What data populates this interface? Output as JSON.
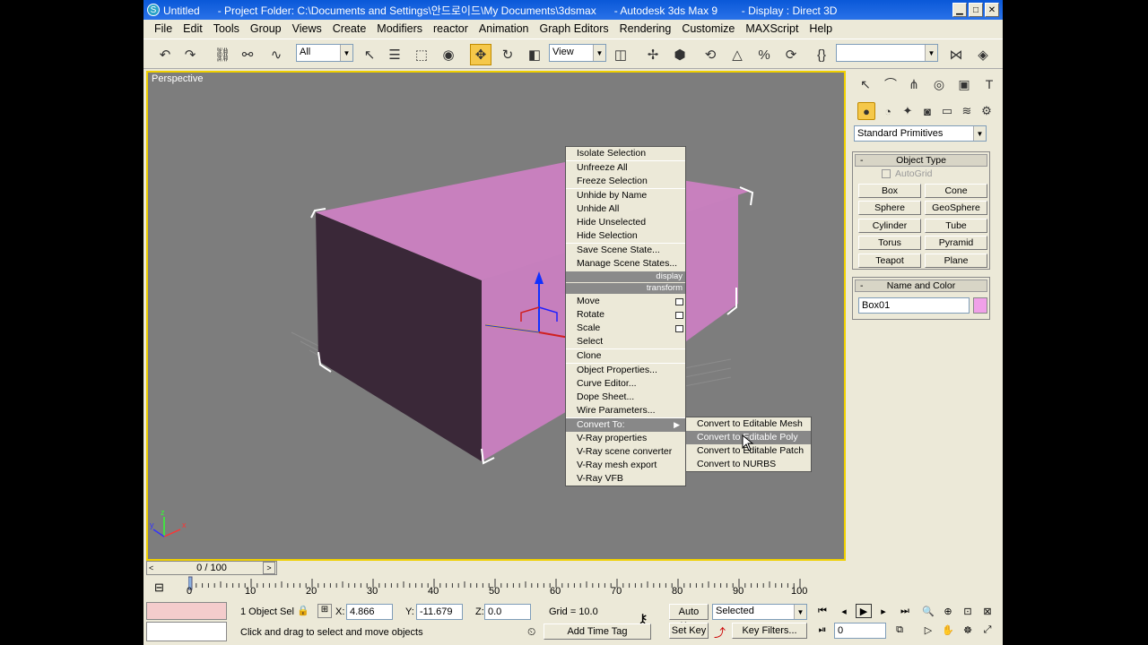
{
  "titlebar": {
    "app_icon": "3ds-max-logo-icon",
    "text": "Untitled      - Project Folder: C:\\Documents and Settings\\안드로이드\\My Documents\\3dsmax      - Autodesk 3ds Max 9        - Display : Direct 3D"
  },
  "menu": [
    "File",
    "Edit",
    "Tools",
    "Group",
    "Views",
    "Create",
    "Modifiers",
    "reactor",
    "Animation",
    "Graph Editors",
    "Rendering",
    "Customize",
    "MAXScript",
    "Help"
  ],
  "toolbar": {
    "selection_filter": "All",
    "ref_coord": "View",
    "named_selection": ""
  },
  "viewport": {
    "label": "Perspective",
    "object_color": "#c77fbe"
  },
  "context_menu": {
    "groups": [
      [
        {
          "label": "Isolate Selection"
        }
      ],
      [
        {
          "label": "Unfreeze All"
        },
        {
          "label": "Freeze Selection"
        }
      ],
      [
        {
          "label": "Unhide by Name"
        },
        {
          "label": "Unhide All"
        },
        {
          "label": "Hide Unselected"
        },
        {
          "label": "Hide Selection"
        }
      ],
      [
        {
          "label": "Save Scene State..."
        },
        {
          "label": "Manage Scene States..."
        }
      ]
    ],
    "header_display": "display",
    "header_transform": "transform",
    "transform_items": [
      "Move",
      "Rotate",
      "Scale",
      "Select"
    ],
    "clone": "Clone",
    "object_items": [
      "Object Properties...",
      "Curve Editor...",
      "Dope Sheet...",
      "Wire Parameters..."
    ],
    "convert_to": "Convert To:",
    "vray_items": [
      "V-Ray properties",
      "V-Ray scene converter",
      "V-Ray mesh export",
      "V-Ray VFB"
    ]
  },
  "submenu": {
    "items": [
      "Convert to Editable Mesh",
      "Convert to Editable Poly",
      "Convert to Editable Patch",
      "Convert to NURBS"
    ],
    "highlighted_index": 1
  },
  "command_panel": {
    "category": "Standard Primitives",
    "object_type_title": "Object Type",
    "autogrid": "AutoGrid",
    "primitives": [
      "Box",
      "Cone",
      "Sphere",
      "GeoSphere",
      "Cylinder",
      "Tube",
      "Torus",
      "Pyramid",
      "Teapot",
      "Plane"
    ],
    "name_color_title": "Name and Color",
    "object_name": "Box01",
    "color_swatch": "#f0a0e8"
  },
  "timeline": {
    "frame": "0 / 100",
    "ticks": [
      "0",
      "10",
      "20",
      "30",
      "40",
      "50",
      "60",
      "70",
      "80",
      "90",
      "100"
    ]
  },
  "status": {
    "selection": "1 Object Sel",
    "x_label": "X:",
    "x": "4.866",
    "y_label": "Y:",
    "y": "-11.679",
    "z_label": "Z:",
    "z": "0.0",
    "grid": "Grid = 10.0",
    "prompt": "Click and drag to select and move objects",
    "add_time_tag": "Add Time Tag",
    "auto_key": "Auto Key",
    "set_key": "Set Key",
    "key_mode": "Selected",
    "key_filters": "Key Filters...",
    "current_frame": "0"
  }
}
